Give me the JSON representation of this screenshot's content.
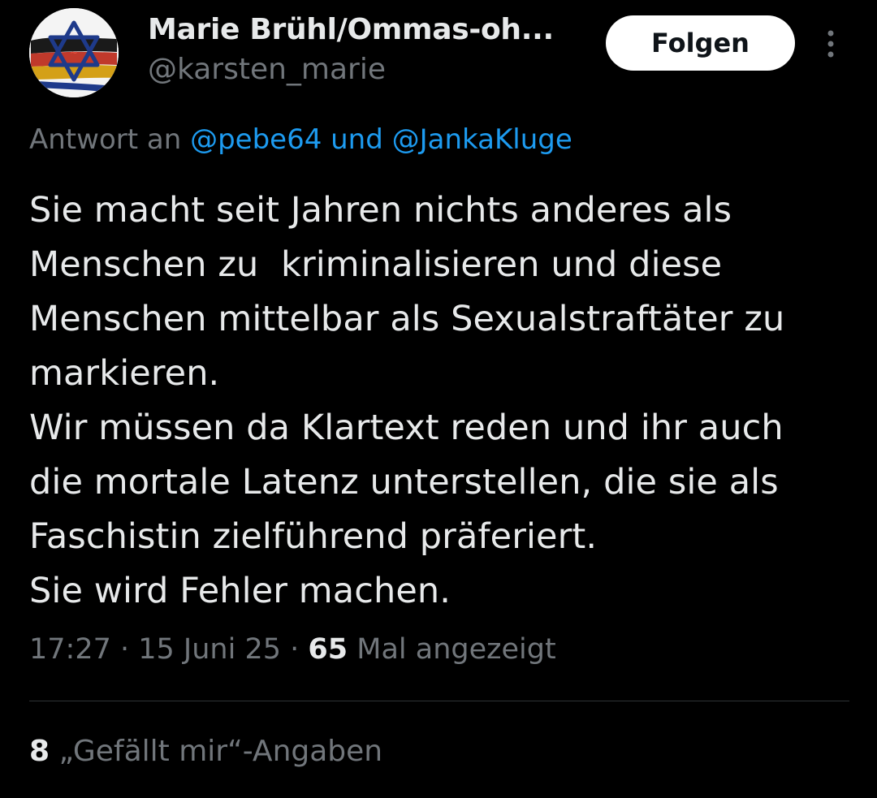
{
  "author": {
    "display_name": "Marie Brühl/Ommas-oh...",
    "handle": "@karsten_marie",
    "avatar_icon": "star-of-david-flag-avatar"
  },
  "header": {
    "follow_label": "Folgen",
    "more_icon": "more-vertical-icon"
  },
  "reply": {
    "prefix": "Antwort an ",
    "users": "@pebe64 und @JankaKluge"
  },
  "tweet": {
    "text": "Sie macht seit Jahren nichts anderes als\nMenschen zu  kriminalisieren und diese\nMenschen mittelbar als Sexualstraftäter zu\nmarkieren.\nWir müssen da Klartext reden und ihr auch\ndie mortale Latenz unterstellen, die sie als\nFaschistin zielführend präferiert.\nSie wird Fehler machen."
  },
  "meta": {
    "time": "17:27",
    "sep1": " · ",
    "date": "15 Juni 25",
    "sep2": " · ",
    "views_count": "65",
    "views_label": " Mal angezeigt"
  },
  "likes": {
    "count": "8",
    "label": " „Gefällt mir“-Angaben"
  },
  "colors": {
    "background": "#000000",
    "text": "#e7e9ea",
    "secondary": "#71767b",
    "link": "#1d9bf0",
    "divider": "#2f3336"
  }
}
